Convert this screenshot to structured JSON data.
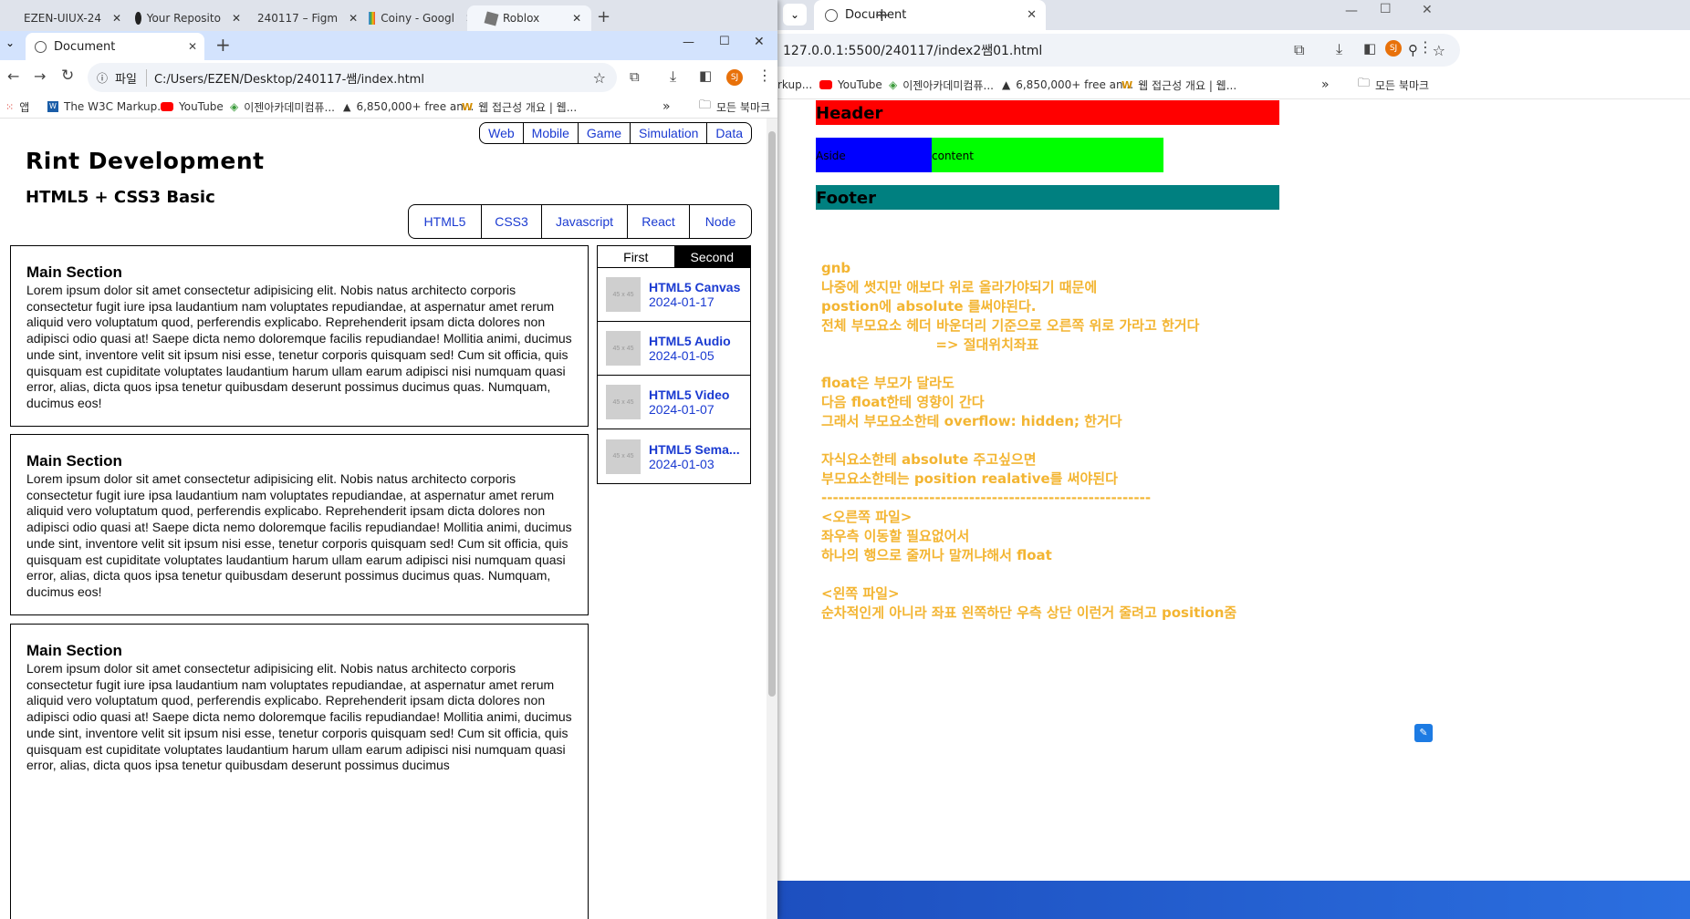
{
  "right_window": {
    "tab_title": "Document",
    "address": "127.0.0.1:5500/240117/index2쌤01.html",
    "bookmarks": [
      "rkup...",
      "YouTube",
      "이젠아카데미컴퓨...",
      "6,850,000+ free an...",
      "웹 접근성 개요 | 웹...",
      "모든 북마크"
    ],
    "page": {
      "header_label": "Header",
      "aside_label": "Aside",
      "content_label": "content",
      "footer_label": "Footer",
      "notes": "gnb\n나중에 썻지만 애보다 위로 올라가야되기 때문에\npostion에 absolute 를써야된다.\n전체 부모요소 헤더 바운더리 기준으로 오른쪽 위로 가라고 한거다\n                        => 절대위치좌표\n\nfloat은 부모가 달라도\n다음 float한테 영향이 간다\n그래서 부모요소한테 overflow: hidden; 한거다\n\n자식요소한테 absolute 주고싶으면\n부모요소한테는 position realative를 써야된다\n----------------------------------------------------------\n<오른쪽 파일>\n좌우측 이동할 필요없어서\n하나의 행으로 줄꺼나 말꺼냐해서 float\n\n<왼쪽 파일>\n순차적인게 아니라 좌표 왼쪽하단 우측 상단 이런거 줄려고 position줌",
      "colors": {
        "header": "#ff0000",
        "aside": "#0000ff",
        "content": "#00ff00",
        "footer": "#008080",
        "notes": "#f3b532"
      }
    }
  },
  "left_window": {
    "outer_tabs": [
      "EZEN-UIUX-24",
      "Your Reposito",
      "240117 – Figm",
      "Coiny - Googl",
      "Roblox"
    ],
    "tab_title": "Document",
    "address_scheme": "파일",
    "address": "C:/Users/EZEN/Desktop/240117-쌤/index.html",
    "bookmarks": [
      "앱",
      "The W3C Markup...",
      "YouTube",
      "이젠아카데미컴퓨...",
      "6,850,000+ free an...",
      "웹 접근성 개요 | 웹...",
      "모든 북마크"
    ],
    "profile": "SJ",
    "page": {
      "gnb": [
        "Web",
        "Mobile",
        "Game",
        "Simulation",
        "Data"
      ],
      "logo": "Rint Development",
      "subtitle": "HTML5 + CSS3 Basic",
      "lnb": [
        "HTML5",
        "CSS3",
        "Javascript",
        "React",
        "Node"
      ],
      "sections": [
        {
          "title": "Main Section",
          "text": "Lorem ipsum dolor sit amet consectetur adipisicing elit. Nobis natus architecto corporis consectetur fugit iure ipsa laudantium nam voluptates repudiandae, at aspernatur amet rerum aliquid vero voluptatum quod, perferendis explicabo. Reprehenderit ipsam dicta dolores non adipisci odio quasi at! Saepe dicta nemo doloremque facilis repudiandae! Mollitia animi, ducimus unde sint, inventore velit sit ipsum nisi esse, tenetur corporis quisquam sed! Cum sit officia, quis quisquam est cupiditate voluptates laudantium harum ullam earum adipisci nisi numquam quasi error, alias, dicta quos ipsa tenetur quibusdam deserunt possimus ducimus quas. Numquam, ducimus eos!"
        },
        {
          "title": "Main Section",
          "text": "Lorem ipsum dolor sit amet consectetur adipisicing elit. Nobis natus architecto corporis consectetur fugit iure ipsa laudantium nam voluptates repudiandae, at aspernatur amet rerum aliquid vero voluptatum quod, perferendis explicabo. Reprehenderit ipsam dicta dolores non adipisci odio quasi at! Saepe dicta nemo doloremque facilis repudiandae! Mollitia animi, ducimus unde sint, inventore velit sit ipsum nisi esse, tenetur corporis quisquam sed! Cum sit officia, quis quisquam est cupiditate voluptates laudantium harum ullam earum adipisci nisi numquam quasi error, alias, dicta quos ipsa tenetur quibusdam deserunt possimus ducimus quas. Numquam, ducimus eos!"
        },
        {
          "title": "Main Section",
          "text": "Lorem ipsum dolor sit amet consectetur adipisicing elit. Nobis natus architecto corporis consectetur fugit iure ipsa laudantium nam voluptates repudiandae, at aspernatur amet rerum aliquid vero voluptatum quod, perferendis explicabo. Reprehenderit ipsam dicta dolores non adipisci odio quasi at! Saepe dicta nemo doloremque facilis repudiandae! Mollitia animi, ducimus unde sint, inventore velit sit ipsum nisi esse, tenetur corporis quisquam sed! Cum sit officia, quis quisquam est cupiditate voluptates laudantium harum ullam earum adipisci nisi numquam quasi error, alias, dicta quos ipsa tenetur quibusdam deserunt possimus ducimus"
        }
      ],
      "tabs": {
        "first": "First",
        "second": "Second"
      },
      "news": [
        {
          "title": "HTML5 Canvas",
          "date": "2024-01-17",
          "thumb": "45 x 45"
        },
        {
          "title": "HTML5 Audio",
          "date": "2024-01-05",
          "thumb": "45 x 45"
        },
        {
          "title": "HTML5 Video",
          "date": "2024-01-07",
          "thumb": "45 x 45"
        },
        {
          "title": "HTML5 Sema...",
          "date": "2024-01-03",
          "thumb": "45 x 45"
        }
      ]
    }
  }
}
